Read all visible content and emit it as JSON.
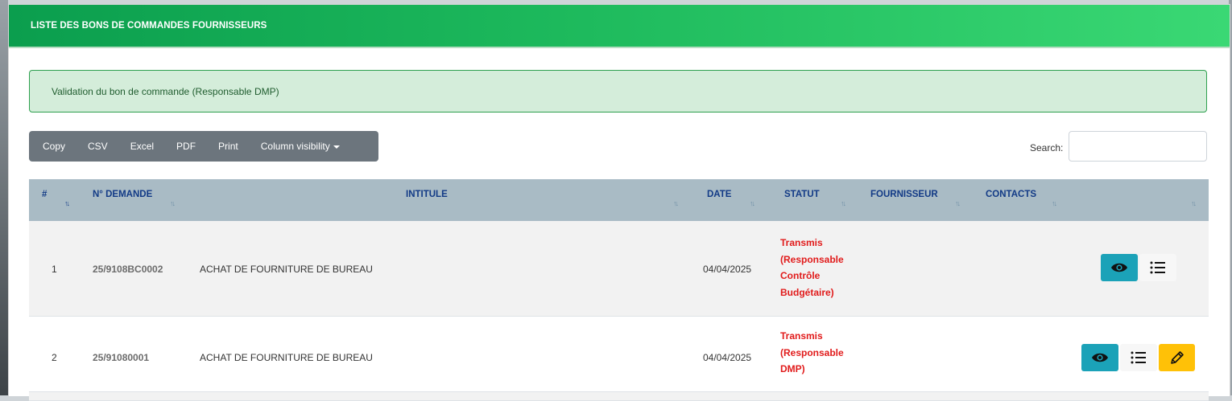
{
  "header": {
    "title": "LISTE DES BONS DE COMMANDES FOURNISSEURS"
  },
  "alert": {
    "message": "Validation du bon de commande (Responsable DMP)"
  },
  "toolbar": {
    "buttons": [
      "Copy",
      "CSV",
      "Excel",
      "PDF",
      "Print",
      "Column visibility"
    ]
  },
  "search": {
    "label": "Search:",
    "value": ""
  },
  "table": {
    "columns": [
      "#",
      "N° DEMANDE",
      "INTITULE",
      "DATE",
      "STATUT",
      "FOURNISSEUR",
      "CONTACTS",
      ""
    ],
    "rows": [
      {
        "index": "1",
        "numero": "25/9108BC0002",
        "intitule": "ACHAT DE FOURNITURE DE BUREAU",
        "date": "04/04/2025",
        "statut_lines": [
          "Transmis",
          "(Responsable",
          "Contrôle",
          "Budgétaire)"
        ],
        "fournisseur": "",
        "contacts": "",
        "actions": [
          "eye-icon",
          "list-icon"
        ]
      },
      {
        "index": "2",
        "numero": "25/91080001",
        "intitule": "ACHAT DE FOURNITURE DE BUREAU",
        "date": "04/04/2025",
        "statut_lines": [
          "Transmis",
          "(Responsable",
          "DMP)"
        ],
        "fournisseur": "",
        "contacts": "",
        "actions": [
          "eye-icon",
          "list-icon",
          "pencil-icon"
        ]
      }
    ]
  },
  "colors": {
    "header_gradient_start": "#0b9e4e",
    "header_gradient_end": "#3ad874",
    "alert_bg": "#d4edda",
    "table_head_bg": "#a9bbc5",
    "statut_red": "#e11b1b",
    "view_btn": "#1ba2b8",
    "edit_btn": "#ffc107"
  }
}
